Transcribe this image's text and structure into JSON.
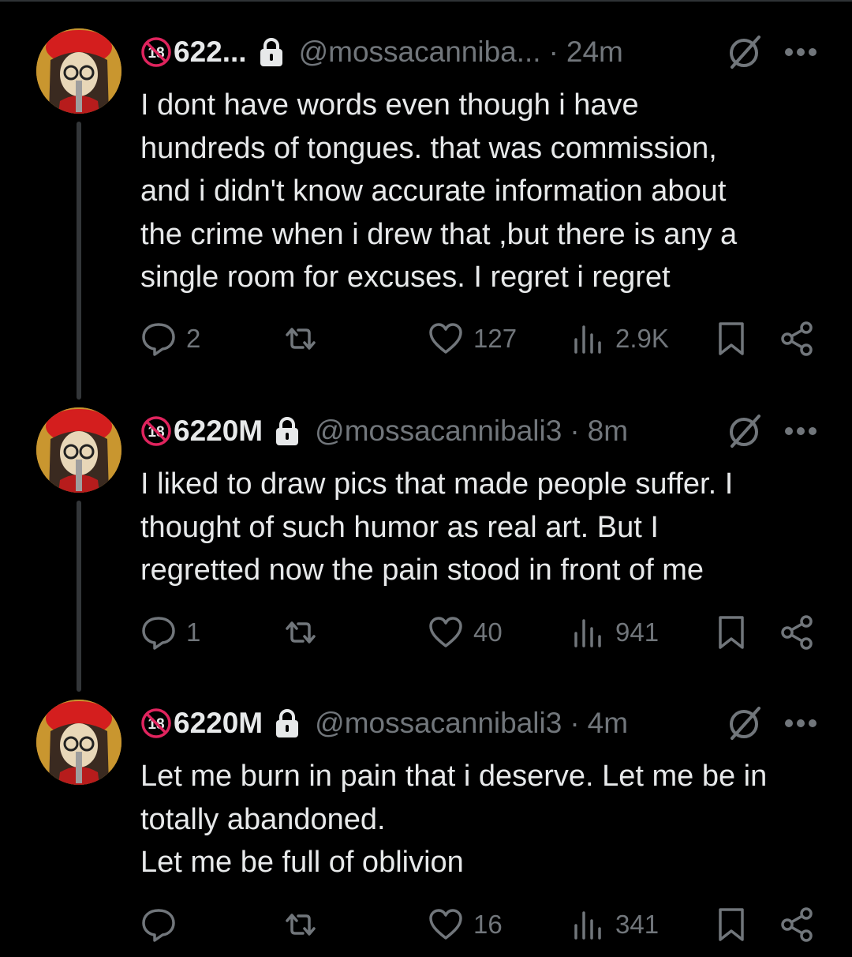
{
  "tweets": [
    {
      "name": "622...",
      "handle": "@mossacanniba...",
      "time": "24m",
      "text": "I dont have words even though i have\nhundreds of tongues. that was commission,\nand i didn't know accurate information about\nthe crime when i drew that ,but there is any a\nsingle room for excuses. I regret i regret",
      "replies": "2",
      "retweets": "",
      "likes": "127",
      "views": "2.9K"
    },
    {
      "name": "6220M",
      "handle": "@mossacannibali3",
      "time": "8m",
      "text": "I liked to draw pics that made people suffer. I\nthought of such humor as real art. But I\nregretted now the pain stood in front of me",
      "replies": "1",
      "retweets": "",
      "likes": "40",
      "views": "941"
    },
    {
      "name": "6220M",
      "handle": "@mossacannibali3",
      "time": "4m",
      "text": "Let me burn in pain that i deserve. Let me be in\ntotally abandoned.\nLet me be full of oblivion",
      "replies": "",
      "retweets": "",
      "likes": "16",
      "views": "341"
    }
  ],
  "separator": "·",
  "icons": {
    "badge": "18-plus-prohibited-icon",
    "lock": "lock-icon",
    "slash": "slash-circle-icon",
    "more": "more-dots-icon",
    "reply": "reply-icon",
    "retweet": "retweet-icon",
    "like": "heart-icon",
    "views": "views-icon",
    "bookmark": "bookmark-icon",
    "share": "share-icon"
  },
  "colors": {
    "background": "#000000",
    "text": "#e7e9ea",
    "secondary": "#71767b",
    "badge_red": "#e0245e"
  }
}
